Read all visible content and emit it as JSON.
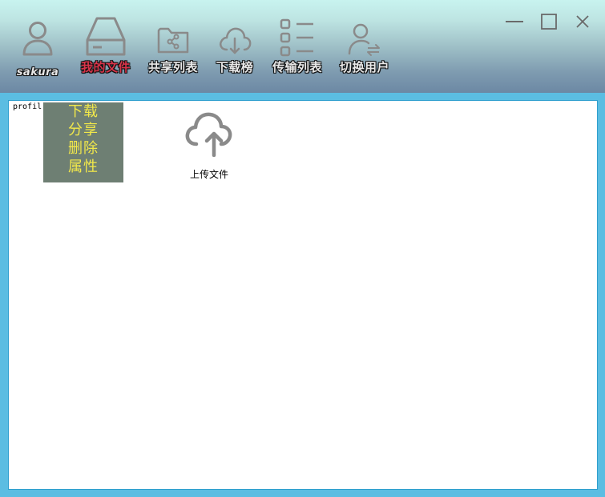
{
  "header": {
    "username": "sakura",
    "nav": [
      {
        "id": "my-files",
        "label": "我的文件",
        "icon": "drive-icon",
        "active": true
      },
      {
        "id": "share-list",
        "label": "共享列表",
        "icon": "shared-folder-icon",
        "active": false
      },
      {
        "id": "download",
        "label": "下载榜",
        "icon": "cloud-download-icon",
        "active": false
      },
      {
        "id": "transfer-list",
        "label": "传输列表",
        "icon": "list-icon",
        "active": false
      },
      {
        "id": "switch-user",
        "label": "切换用户",
        "icon": "switch-user-icon",
        "active": false
      }
    ],
    "window_controls": [
      "minimize-icon",
      "maximize-icon",
      "close-icon"
    ]
  },
  "colors": {
    "active_nav": "#d8344a",
    "menu_bg": "#6e7f73",
    "menu_text": "#f2e84a",
    "frame": "#5bbde2",
    "icon_gray": "#8a8a8a"
  },
  "content": {
    "file_name": "profil      d  word.txt",
    "upload_label": "上传文件",
    "context_menu": [
      {
        "id": "download",
        "label": "下载"
      },
      {
        "id": "share",
        "label": "分享"
      },
      {
        "id": "delete",
        "label": "删除"
      },
      {
        "id": "properties",
        "label": "属性"
      }
    ]
  }
}
